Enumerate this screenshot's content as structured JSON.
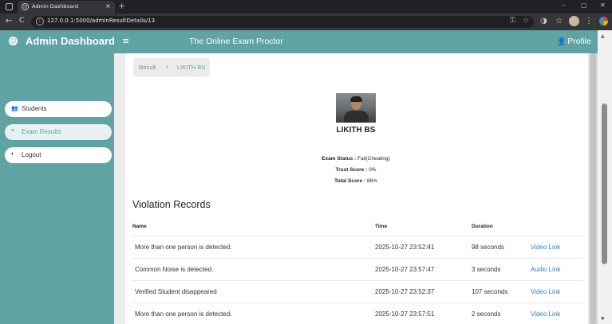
{
  "browser": {
    "tab_title": "Admin Dashboard",
    "tab_close": "×",
    "new_tab": "+",
    "url": "127.0.0.1:5000/adminResultDetails/13",
    "back": "←",
    "reload": "C",
    "win_min": "–",
    "win_max": "▢",
    "win_close": "✕",
    "icons": [
      "info-icon",
      "key-icon",
      "star-icon",
      "extensions-icon",
      "bookmarks-icon",
      "profile-avatar",
      "browser-menu-icon"
    ]
  },
  "header": {
    "brand": "Admin Dashboard",
    "app_title": "The Online Exam Proctor",
    "profile": "Profile",
    "brand_color": "#5fa3a3"
  },
  "sidebar": {
    "items": [
      {
        "label": "Students",
        "icon": "users-icon",
        "active": false
      },
      {
        "label": "Exam Results",
        "icon": "list-icon",
        "active": true
      },
      {
        "label": "Logout",
        "icon": "logout-icon",
        "active": false
      }
    ]
  },
  "breadcrumb": {
    "parent": "Result",
    "separator": "›",
    "current": "LIKITH BS"
  },
  "student": {
    "name": "LIKITH BS",
    "exam_status_label": "Exam Status :",
    "exam_status": "Fail(Cheating)",
    "trust_score_label": "Trust Score :",
    "trust_score": "0%",
    "total_score_label": "Total Score :",
    "total_score": "86%"
  },
  "violations": {
    "title": "Violation Records",
    "headers": {
      "name": "Name",
      "time": "Time",
      "duration": "Duration"
    },
    "rows": [
      {
        "name": "More than one person is detected.",
        "time": "2025-10-27 23:52:41",
        "duration": "98 seconds",
        "link": "Video Link"
      },
      {
        "name": "Common Noise is detected.",
        "time": "2025-10-27 23:57:47",
        "duration": "3 seconds",
        "link": "Audio Link"
      },
      {
        "name": "Verified Student disappeared",
        "time": "2025-10-27 23:52:37",
        "duration": "107 seconds",
        "link": "Video Link"
      },
      {
        "name": "More than one person is detected.",
        "time": "2025-10-27 23:57:51",
        "duration": "2 seconds",
        "link": "Video Link"
      }
    ]
  }
}
